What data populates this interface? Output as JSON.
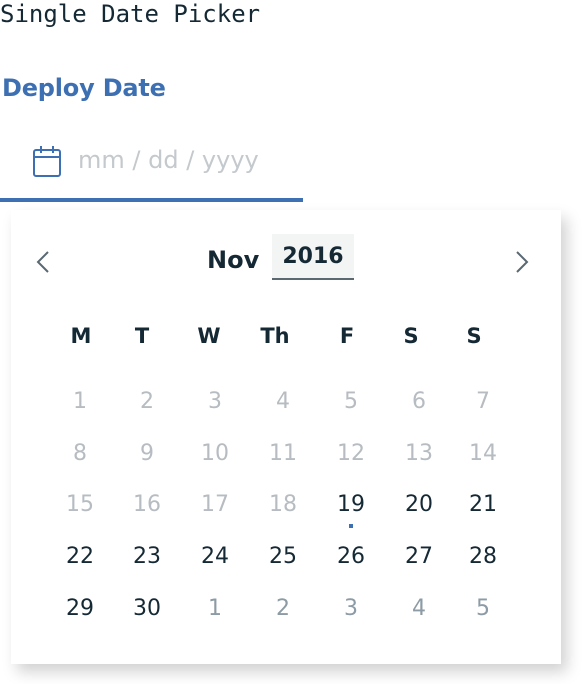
{
  "page": {
    "heading": "Single Date Picker"
  },
  "field": {
    "label": "Deploy Date",
    "placeholder": "mm / dd / yyyy",
    "icon": "calendar-icon",
    "accent": "#3d70b2"
  },
  "calendar": {
    "month": "Nov",
    "year": "2016",
    "prev_icon": "chevron-left-icon",
    "next_icon": "chevron-right-icon",
    "weekdays": [
      "M",
      "T",
      "W",
      "Th",
      "F",
      "S",
      "S"
    ],
    "weeks": [
      [
        "1",
        "2",
        "3",
        "4",
        "5",
        "6",
        "7"
      ],
      [
        "8",
        "9",
        "10",
        "11",
        "12",
        "13",
        "14"
      ],
      [
        "15",
        "16",
        "17",
        "18",
        "19",
        "20",
        "21"
      ],
      [
        "22",
        "23",
        "24",
        "25",
        "26",
        "27",
        "28"
      ],
      [
        "29",
        "30",
        "1",
        "2",
        "3",
        "4",
        "5"
      ]
    ],
    "today": "19"
  }
}
